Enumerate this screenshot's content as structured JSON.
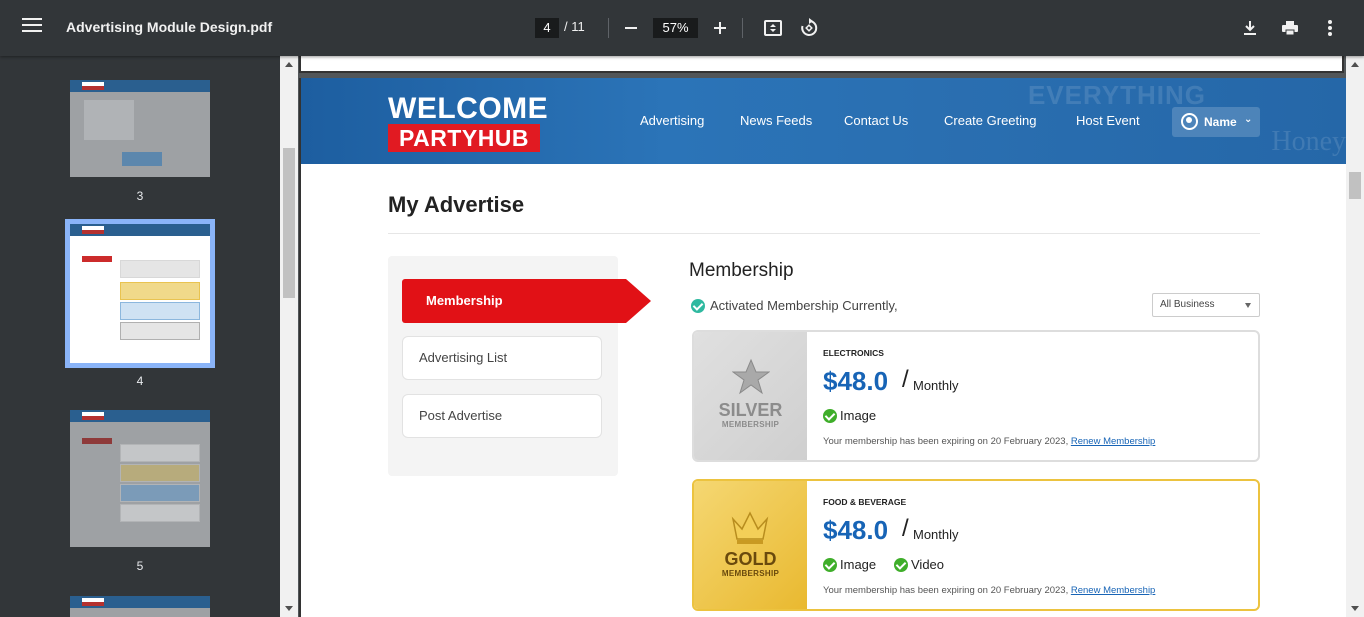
{
  "toolbar": {
    "title": "Advertising Module Design.pdf",
    "current_page": "4",
    "total_pages": "/ 11",
    "zoom": "57%"
  },
  "thumbnails": [
    {
      "num": "3"
    },
    {
      "num": "4"
    },
    {
      "num": "5"
    }
  ],
  "site": {
    "logo_top": "WELCOME",
    "logo_bottom": "PARTYHUB",
    "bg_text_1": "EVERYTHING",
    "bg_text_2": "Honey",
    "nav": [
      "Advertising",
      "News Feeds",
      "Contact Us",
      "Create Greeting",
      "Host Event"
    ],
    "user_name": "Name"
  },
  "page": {
    "heading": "My Advertise",
    "side_menu": {
      "active": "Membership",
      "items": [
        "Advertising List",
        "Post Advertise"
      ]
    },
    "section_title": "Membership",
    "status_text": "Activated Membership Currently,",
    "filter_value": "All Business",
    "cards": [
      {
        "tier": "SILVER",
        "tier_sub": "MEMBERSHIP",
        "category": "ELECTRONICS",
        "price": "$48.0",
        "slash": "/",
        "period": "Monthly",
        "features": [
          "Image"
        ],
        "expiry_text": "Your membership has been expiring on 20 February 2023,",
        "renew_link": "Renew Membership"
      },
      {
        "tier": "GOLD",
        "tier_sub": "MEMBERSHIP",
        "category": "FOOD & BEVERAGE",
        "price": "$48.0",
        "slash": "/",
        "period": "Monthly",
        "features": [
          "Image",
          "Video"
        ],
        "expiry_text": "Your membership has been expiring on 20 February 2023,",
        "renew_link": "Renew Membership"
      }
    ]
  },
  "colors": {
    "accent_red": "#e11116",
    "price_blue": "#1764b6",
    "check_green": "#3fae2a",
    "status_teal": "#2fb9a0",
    "gold_border": "#ecc33f"
  }
}
